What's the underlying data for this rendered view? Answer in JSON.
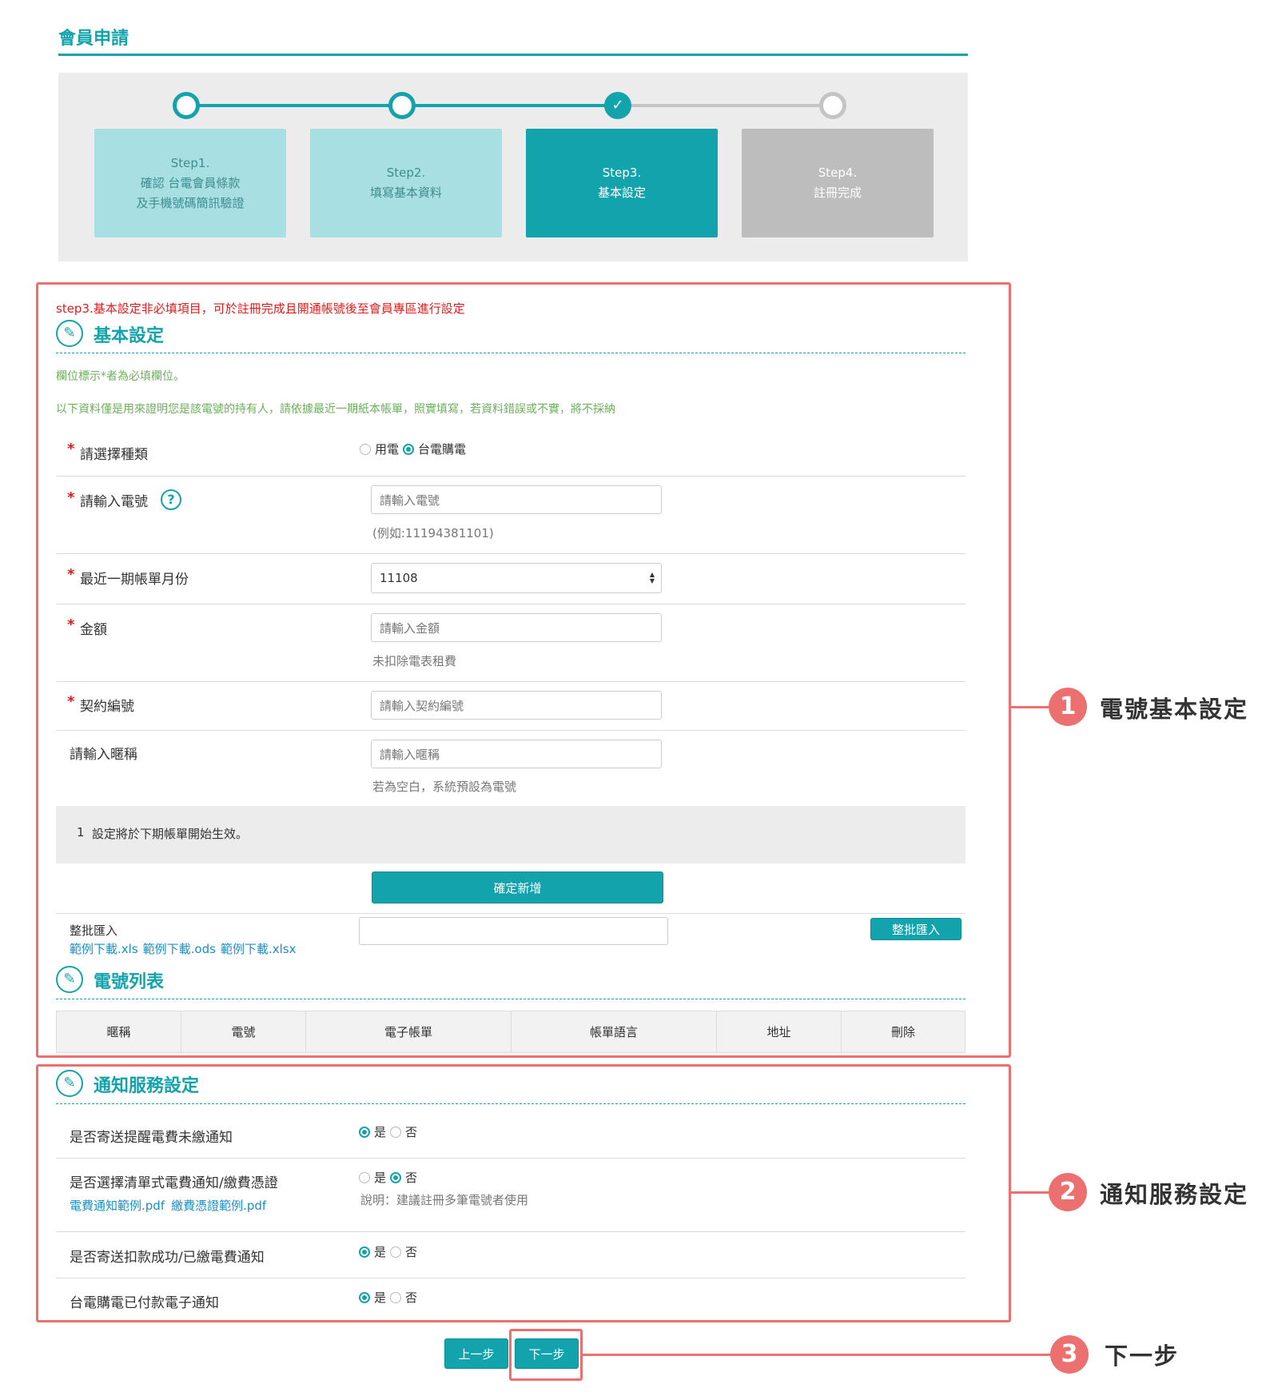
{
  "page_title": "會員申請",
  "steps": [
    {
      "lines": [
        "Step1.",
        "確認 台電會員條款",
        "及手機號碼簡訊驗證"
      ]
    },
    {
      "lines": [
        "Step2.",
        "填寫基本資料"
      ]
    },
    {
      "lines": [
        "Step3.",
        "基本設定"
      ]
    },
    {
      "lines": [
        "Step4.",
        "註冊完成"
      ]
    }
  ],
  "check_mark": "✓",
  "basic": {
    "notice": "step3.基本設定非必填項目，可於註冊完成且開通帳號後至會員專區進行設定",
    "section_title": "基本設定",
    "hint_required": "欄位標示*者為必填欄位。",
    "hint_proof": "以下資料僅是用來證明您是該電號的持有人，請依據最近一期紙本帳單，照實填寫，若資料錯誤或不實，將不採納",
    "required_mark": "*",
    "type_label": "請選擇種類",
    "type_options": [
      "用電",
      "台電購電"
    ],
    "type_selected": "台電購電",
    "elec_label": "請輸入電號",
    "elec_help_icon": "?",
    "elec_placeholder": "請輸入電號",
    "elec_example": "(例如:11194381101)",
    "bill_month_label": "最近一期帳單月份",
    "bill_month_value": "11108",
    "amount_label": "金額",
    "amount_placeholder": "請輸入金額",
    "amount_note": "未扣除電表租費",
    "contract_label": "契約編號",
    "contract_placeholder": "請輸入契約編號",
    "nickname_label": "請輸入暱稱",
    "nickname_placeholder": "請輸入暱稱",
    "nickname_note": "若為空白，系統預設為電號",
    "note_number": "1",
    "note_text": "設定將於下期帳單開始生效。",
    "confirm_button": "確定新增",
    "batch_label": "整批匯入",
    "batch_links": [
      "範例下載.xls",
      "範例下載.ods",
      "範例下載.xlsx"
    ],
    "batch_button": "整批匯入"
  },
  "list": {
    "section_title": "電號列表",
    "columns": [
      "暱稱",
      "電號",
      "電子帳單",
      "帳單語言",
      "地址",
      "刪除"
    ]
  },
  "notify": {
    "section_title": "通知服務設定",
    "rows": [
      {
        "label": "是否寄送提醒電費未繳通知",
        "options": [
          "是",
          "否"
        ],
        "selected": "是"
      },
      {
        "label": "是否選擇清單式電費通知/繳費憑證",
        "options": [
          "是",
          "否"
        ],
        "selected": "否",
        "links": [
          "電費通知範例.pdf",
          "繳費憑證範例.pdf"
        ],
        "note": "說明：建議註冊多筆電號者使用"
      },
      {
        "label": "是否寄送扣款成功/已繳電費通知",
        "options": [
          "是",
          "否"
        ],
        "selected": "是"
      },
      {
        "label": "台電購電已付款電子通知",
        "options": [
          "是",
          "否"
        ],
        "selected": "是"
      }
    ]
  },
  "nav": {
    "prev": "上一步",
    "next": "下一步"
  },
  "annotations": [
    {
      "num": "1",
      "label": "電號基本設定"
    },
    {
      "num": "2",
      "label": "通知服務設定"
    },
    {
      "num": "3",
      "label": "下一步"
    }
  ],
  "colors": {
    "accent": "#13a3ad",
    "annotation": "#ec7070",
    "required": "#e11b1b",
    "hint": "#6bb05b",
    "link": "#1a8fc4"
  }
}
